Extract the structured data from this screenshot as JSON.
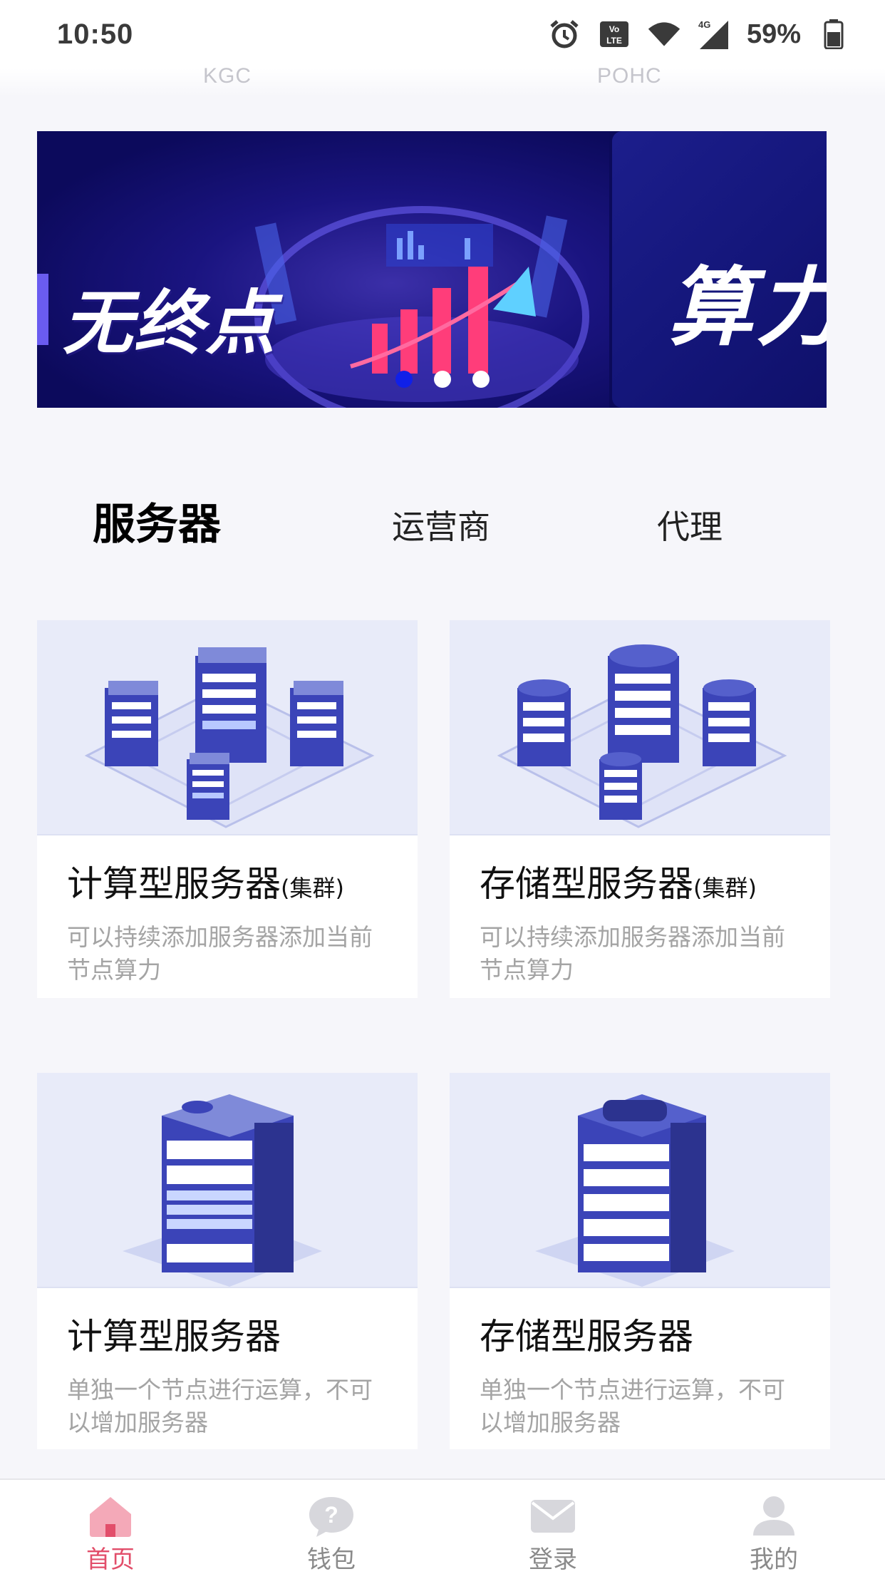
{
  "status_bar": {
    "time": "10:50",
    "battery": "59%",
    "icons": [
      "alarm-icon",
      "volte-icon",
      "wifi-icon",
      "signal-4g-icon",
      "battery-icon"
    ]
  },
  "top_partial": {
    "left_label": "KGC",
    "right_label": "POHC"
  },
  "banner": {
    "slide_main_title": "无终点",
    "slide_next_title": "算力",
    "active_index": 0,
    "count": 3
  },
  "tabs": [
    {
      "label": "服务器",
      "active": true
    },
    {
      "label": "运营商",
      "active": false
    },
    {
      "label": "代理",
      "active": false
    }
  ],
  "cards": [
    {
      "title": "计算型服务器",
      "suffix": "(集群)",
      "description": "可以持续添加服务器添加当前节点算力",
      "image": "server-cluster-illustration"
    },
    {
      "title": "存储型服务器",
      "suffix": "(集群)",
      "description": "可以持续添加服务器添加当前节点算力",
      "image": "storage-cluster-illustration"
    },
    {
      "title": "计算型服务器",
      "suffix": "",
      "description": "单独一个节点进行运算，不可以增加服务器",
      "image": "single-server-illustration"
    },
    {
      "title": "存储型服务器",
      "suffix": "",
      "description": "单独一个节点进行运算，不可以增加服务器",
      "image": "single-storage-illustration"
    }
  ],
  "bottom_nav": [
    {
      "label": "首页",
      "icon": "home-icon",
      "active": true
    },
    {
      "label": "钱包",
      "icon": "question-icon",
      "active": false
    },
    {
      "label": "登录",
      "icon": "mail-icon",
      "active": false
    },
    {
      "label": "我的",
      "icon": "user-icon",
      "active": false
    }
  ],
  "colors": {
    "accent_active_nav": "#e24e6a",
    "banner_dot_active": "#1020e8",
    "card_image_bg": "#e8ebf9",
    "server_blue": "#3b44b8"
  }
}
